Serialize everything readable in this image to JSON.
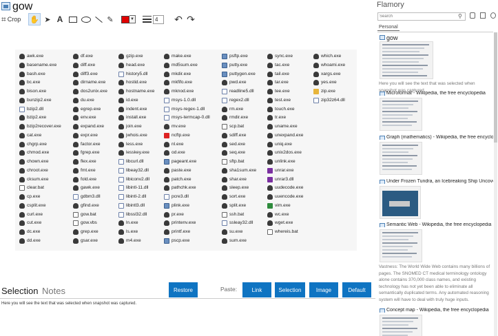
{
  "window": {
    "title": "gow"
  },
  "toolbar": {
    "crop_label": "Crop",
    "stroke_size": "4",
    "current_color": "#e00000"
  },
  "snapshot": {
    "columns": [
      [
        "awk.exe",
        "basename.exe",
        "bash.exe",
        "bc.exe",
        "bison.exe",
        "bunzip2.exe",
        "bzip2.dll",
        "bzip2.exe",
        "bzip2recover.exe",
        "cat.exe",
        "chgrp.exe",
        "chmod.exe",
        "chown.exe",
        "chroot.exe",
        "cksum.exe",
        "clear.bat",
        "cp.exe",
        "csplit.exe",
        "curl.exe",
        "cut.exe",
        "dc.exe",
        "dd.exe"
      ],
      [
        "df.exe",
        "diff.exe",
        "diff3.exe",
        "dirname.exe",
        "dos2unix.exe",
        "du.exe",
        "egrep.exe",
        "env.exe",
        "expand.exe",
        "expr.exe",
        "factor.exe",
        "fgrep.exe",
        "flex.exe",
        "fmt.exe",
        "fold.exe",
        "gawk.exe",
        "gdbm3.dll",
        "gfind.exe",
        "gow.bat",
        "gow.vbs",
        "grep.exe",
        "gsar.exe"
      ],
      [
        "gzip.exe",
        "head.exe",
        "history5.dll",
        "hostid.exe",
        "hostname.exe",
        "id.exe",
        "indent.exe",
        "install.exe",
        "join.exe",
        "jwhois.exe",
        "less.exe",
        "lesskey.exe",
        "libcurl.dll",
        "libeay32.dll",
        "libiconv2.dll",
        "libintl-11.dll",
        "libintl-2.dll",
        "libintl3.dll",
        "libssl32.dll",
        "ln.exe",
        "ls.exe",
        "m4.exe"
      ],
      [
        "make.exe",
        "md5sum.exe",
        "mkdir.exe",
        "mkfifo.exe",
        "mknod.exe",
        "msys-1.0.dll",
        "msys-regex-1.dll",
        "msys-termcap-0.dll",
        "mv.exe",
        "ncftp.exe",
        "nl.exe",
        "od.exe",
        "pageant.exe",
        "paste.exe",
        "patch.exe",
        "pathchk.exe",
        "pcre3.dll",
        "plink.exe",
        "pr.exe",
        "printenv.exe",
        "printf.exe",
        "pscp.exe"
      ],
      [
        "psftp.exe",
        "putty.exe",
        "puttygen.exe",
        "pwd.exe",
        "readline5.dll",
        "regex2.dll",
        "rm.exe",
        "rmdir.exe",
        "scp.bat",
        "sdiff.exe",
        "sed.exe",
        "seq.exe",
        "sftp.bat",
        "sha1sum.exe",
        "shar.exe",
        "sleep.exe",
        "sort.exe",
        "split.exe",
        "ssh.bat",
        "ssleay32.dll",
        "su.exe",
        "sum.exe"
      ],
      [
        "sync.exe",
        "tac.exe",
        "tail.exe",
        "tar.exe",
        "tee.exe",
        "test.exe",
        "touch.exe",
        "tr.exe",
        "uname.exe",
        "unexpand.exe",
        "uniq.exe",
        "unix2dos.exe",
        "unlink.exe",
        "unrar.exe",
        "unrar3.dll",
        "uudecode.exe",
        "uuencode.exe",
        "vim.exe",
        "wc.exe",
        "wget.exe",
        "whereis.bat"
      ],
      [
        "which.exe",
        "whoami.exe",
        "xargs.exe",
        "yes.exe",
        "zip.exe",
        "zip32z64.dll"
      ]
    ]
  },
  "bottom": {
    "tab_selection": "Selection",
    "tab_notes": "Notes",
    "restore": "Restore",
    "paste_label": "Paste:",
    "link": "Link",
    "selection": "Selection",
    "image": "Image",
    "default": "Default",
    "selection_text": "Here you will see the text that was selected when snapshot was captured."
  },
  "sidebar": {
    "title": "Flamory",
    "search_placeholder": "Search",
    "tab": "Personal",
    "items": [
      {
        "title": "gow",
        "desc": "Here you will see the text that was selected when snapshot was captured."
      },
      {
        "title": "Microformat - Wikipedia, the free encyclopedia",
        "desc": ""
      },
      {
        "title": "Graph (mathematics) - Wikipedia, the free encyclopedia",
        "desc": ""
      },
      {
        "title": "Under Frozen Tundra, an Icebreaking Ship Uncovers",
        "desc": ""
      },
      {
        "title": "Semantic Web - Wikipedia, the free encyclopedia",
        "desc": "Vastness: The World Wide Web contains many billions of pages. The SNOMED CT medical terminology ontology alone contains 370,000 class names, and existing technology has not yet been able to eliminate all semantically duplicated terms. Any automated reasoning system will have to deal with truly huge inputs."
      },
      {
        "title": "Concept map - Wikipedia, the free encyclopedia",
        "desc": ""
      }
    ]
  }
}
